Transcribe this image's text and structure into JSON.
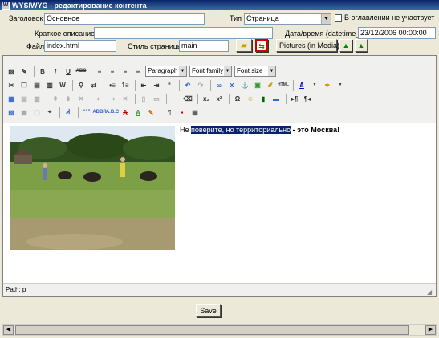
{
  "window": {
    "title": "WYSIWYG - редактирование контента"
  },
  "form": {
    "title_label": "Заголовок",
    "title_value": "Основное",
    "type_label": "Тип",
    "type_value": "Страница",
    "toc_label": "В оглавлении не участвует",
    "short_desc_label": "Краткое описание",
    "short_desc_value": "",
    "datetime_label": "Дата/время (datetime_)",
    "datetime_value": "23/12/2006 00:00:00",
    "file_label": "Файл",
    "file_value": "index.html",
    "style_label": "Стиль страницы",
    "style_value": "main",
    "pictures_button": "Pictures (in Media)"
  },
  "toolbar": {
    "format_select": "Paragraph",
    "font_family_select": "Font family",
    "font_size_select": "Font size",
    "row1": [
      {
        "icon": "select-all-icon",
        "glyph": "▧"
      },
      {
        "icon": "cleanup-icon",
        "glyph": "✎"
      },
      {
        "icon": "bold-icon",
        "glyph": "B"
      },
      {
        "icon": "italic-icon",
        "glyph": "I"
      },
      {
        "icon": "underline-icon",
        "glyph": "U"
      },
      {
        "icon": "strikethrough-icon",
        "glyph": "ABC"
      },
      {
        "icon": "align-left-icon",
        "glyph": "≡"
      },
      {
        "icon": "align-center-icon",
        "glyph": "≡"
      },
      {
        "icon": "align-right-icon",
        "glyph": "≡"
      },
      {
        "icon": "align-justify-icon",
        "glyph": "≡"
      }
    ],
    "row1b": [
      {
        "icon": "cut-icon",
        "glyph": "✂"
      },
      {
        "icon": "copy-icon",
        "glyph": "❐"
      },
      {
        "icon": "paste-icon",
        "glyph": "📋"
      },
      {
        "icon": "find-icon",
        "glyph": "🔍"
      },
      {
        "icon": "replace-icon",
        "glyph": "⇄"
      },
      {
        "icon": "bullet-list-icon",
        "glyph": "•"
      },
      {
        "icon": "numbered-list-icon",
        "glyph": "1."
      },
      {
        "icon": "outdent-icon",
        "glyph": "⇤"
      },
      {
        "icon": "indent-icon",
        "glyph": "⇥"
      },
      {
        "icon": "blockquote-icon",
        "glyph": "“"
      },
      {
        "icon": "undo-icon",
        "glyph": "↶"
      },
      {
        "icon": "redo-icon",
        "glyph": "↷"
      },
      {
        "icon": "link-icon",
        "glyph": "🔗"
      },
      {
        "icon": "unlink-icon",
        "glyph": "⛓"
      },
      {
        "icon": "anchor-icon",
        "glyph": "⚓"
      },
      {
        "icon": "image-icon",
        "glyph": "▣"
      },
      {
        "icon": "cleanup-brush-icon",
        "glyph": "✐"
      },
      {
        "icon": "html-icon",
        "glyph": "HTML"
      },
      {
        "icon": "text-color-icon",
        "glyph": "A"
      },
      {
        "icon": "background-color-icon",
        "glyph": "✒"
      }
    ],
    "path_label": "Path: p"
  },
  "content": {
    "text_before": "Не ",
    "text_highlight": "поверите, но территориально",
    "text_after": " - это Москва!"
  },
  "save_button": "Save"
}
